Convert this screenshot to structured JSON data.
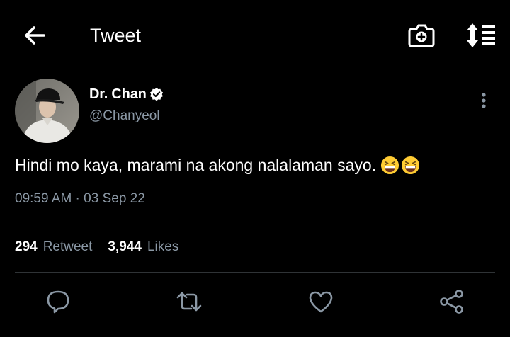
{
  "header": {
    "title": "Tweet",
    "back_icon": "arrow-left-icon",
    "camera_icon": "camera-plus-icon",
    "sort_icon": "sort-list-icon"
  },
  "tweet": {
    "display_name": "Dr. Chan",
    "verified": true,
    "handle": "@Chanyeol",
    "text": "Hindi mo kaya, marami na akong nalalaman sayo.",
    "emojis": [
      "grinning-squinting-face",
      "grinning-squinting-face"
    ],
    "timestamp": "09:59 AM · 03 Sep 22",
    "retweet_count": "294",
    "retweet_label": "Retweet",
    "likes_count": "3,944",
    "likes_label": "Likes"
  },
  "actions": [
    {
      "name": "reply",
      "icon": "reply-bubble-icon"
    },
    {
      "name": "retweet",
      "icon": "retweet-icon"
    },
    {
      "name": "like",
      "icon": "heart-icon"
    },
    {
      "name": "share",
      "icon": "share-icon"
    }
  ],
  "colors": {
    "background": "#000000",
    "text": "#ffffff",
    "secondary_text": "#8b98a5",
    "divider": "#2f3336"
  }
}
